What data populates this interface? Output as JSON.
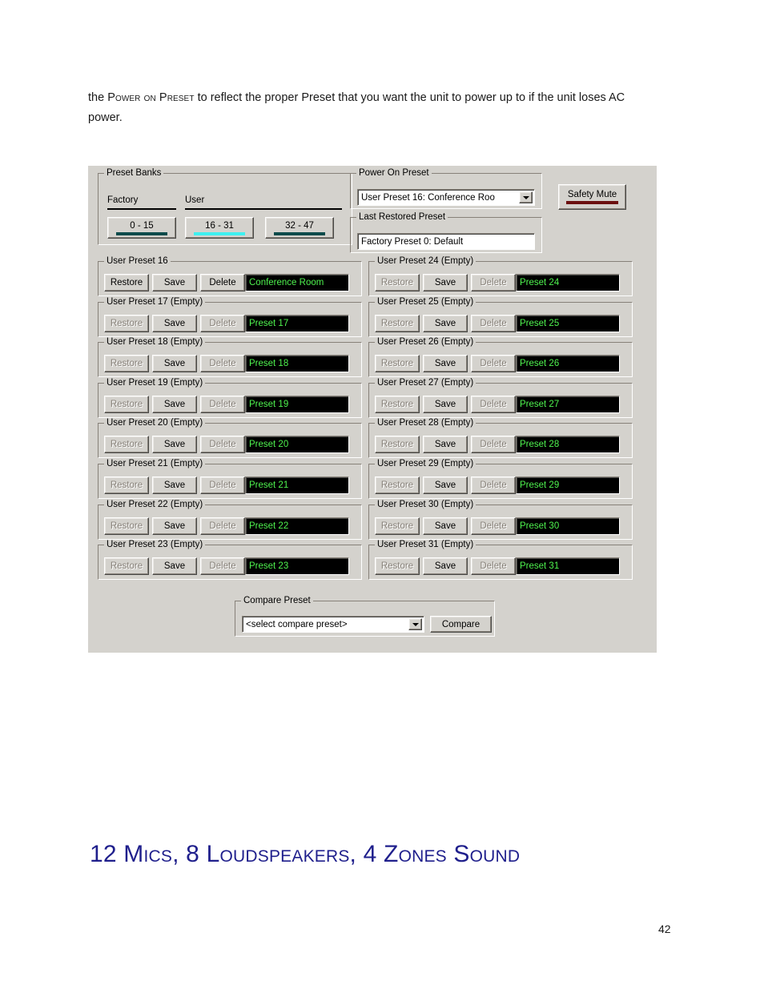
{
  "page": {
    "number": "42",
    "body_text_prefix": "the ",
    "body_text_smallcaps": "Power on Preset",
    "body_text_suffix": " to reflect the proper Preset that you want the unit to power up to if the unit loses AC power.",
    "chapter_heading": "12 Mics, 8 Loudspeakers, 4 Zones Sound",
    "heading_color": "#1f1f8c"
  },
  "dialog": {
    "preset_banks": {
      "title": "Preset Banks",
      "factory_label": "Factory",
      "user_label": "User",
      "banks": [
        {
          "label": "0 - 15",
          "active": false,
          "indicator_color": "#0c4b4b"
        },
        {
          "label": "16 - 31",
          "active": true,
          "indicator_color": "#3ef0f0"
        },
        {
          "label": "32 - 47",
          "active": false,
          "indicator_color": "#0c4b4b"
        }
      ]
    },
    "power_on_preset": {
      "title": "Power On Preset",
      "value": "User Preset 16: Conference Roo",
      "arrow_icon": "chevron-down-icon"
    },
    "last_restored_preset": {
      "title": "Last Restored Preset",
      "value": "Factory Preset 0: Default"
    },
    "safety_mute": {
      "label": "Safety Mute",
      "indicator_color": "#6b0f0f"
    },
    "preset_buttons": {
      "restore": "Restore",
      "save": "Save",
      "delete": "Delete"
    },
    "presets_left": [
      {
        "title": "User Preset 16",
        "name": "Conference Room",
        "empty": false
      },
      {
        "title": "User Preset 17 (Empty)",
        "name": "Preset 17",
        "empty": true
      },
      {
        "title": "User Preset 18 (Empty)",
        "name": "Preset 18",
        "empty": true
      },
      {
        "title": "User Preset 19 (Empty)",
        "name": "Preset 19",
        "empty": true
      },
      {
        "title": "User Preset 20 (Empty)",
        "name": "Preset 20",
        "empty": true
      },
      {
        "title": "User Preset 21 (Empty)",
        "name": "Preset 21",
        "empty": true
      },
      {
        "title": "User Preset 22 (Empty)",
        "name": "Preset 22",
        "empty": true
      },
      {
        "title": "User Preset 23 (Empty)",
        "name": "Preset 23",
        "empty": true
      }
    ],
    "presets_right": [
      {
        "title": "User Preset 24 (Empty)",
        "name": "Preset 24",
        "empty": true
      },
      {
        "title": "User Preset 25 (Empty)",
        "name": "Preset 25",
        "empty": true
      },
      {
        "title": "User Preset 26 (Empty)",
        "name": "Preset 26",
        "empty": true
      },
      {
        "title": "User Preset 27 (Empty)",
        "name": "Preset 27",
        "empty": true
      },
      {
        "title": "User Preset 28 (Empty)",
        "name": "Preset 28",
        "empty": true
      },
      {
        "title": "User Preset 29 (Empty)",
        "name": "Preset 29",
        "empty": true
      },
      {
        "title": "User Preset 30 (Empty)",
        "name": "Preset 30",
        "empty": true
      },
      {
        "title": "User Preset 31 (Empty)",
        "name": "Preset 31",
        "empty": true
      }
    ],
    "compare_preset": {
      "title": "Compare Preset",
      "value": "<select compare preset>",
      "arrow_icon": "chevron-down-icon",
      "compare_label": "Compare"
    }
  }
}
